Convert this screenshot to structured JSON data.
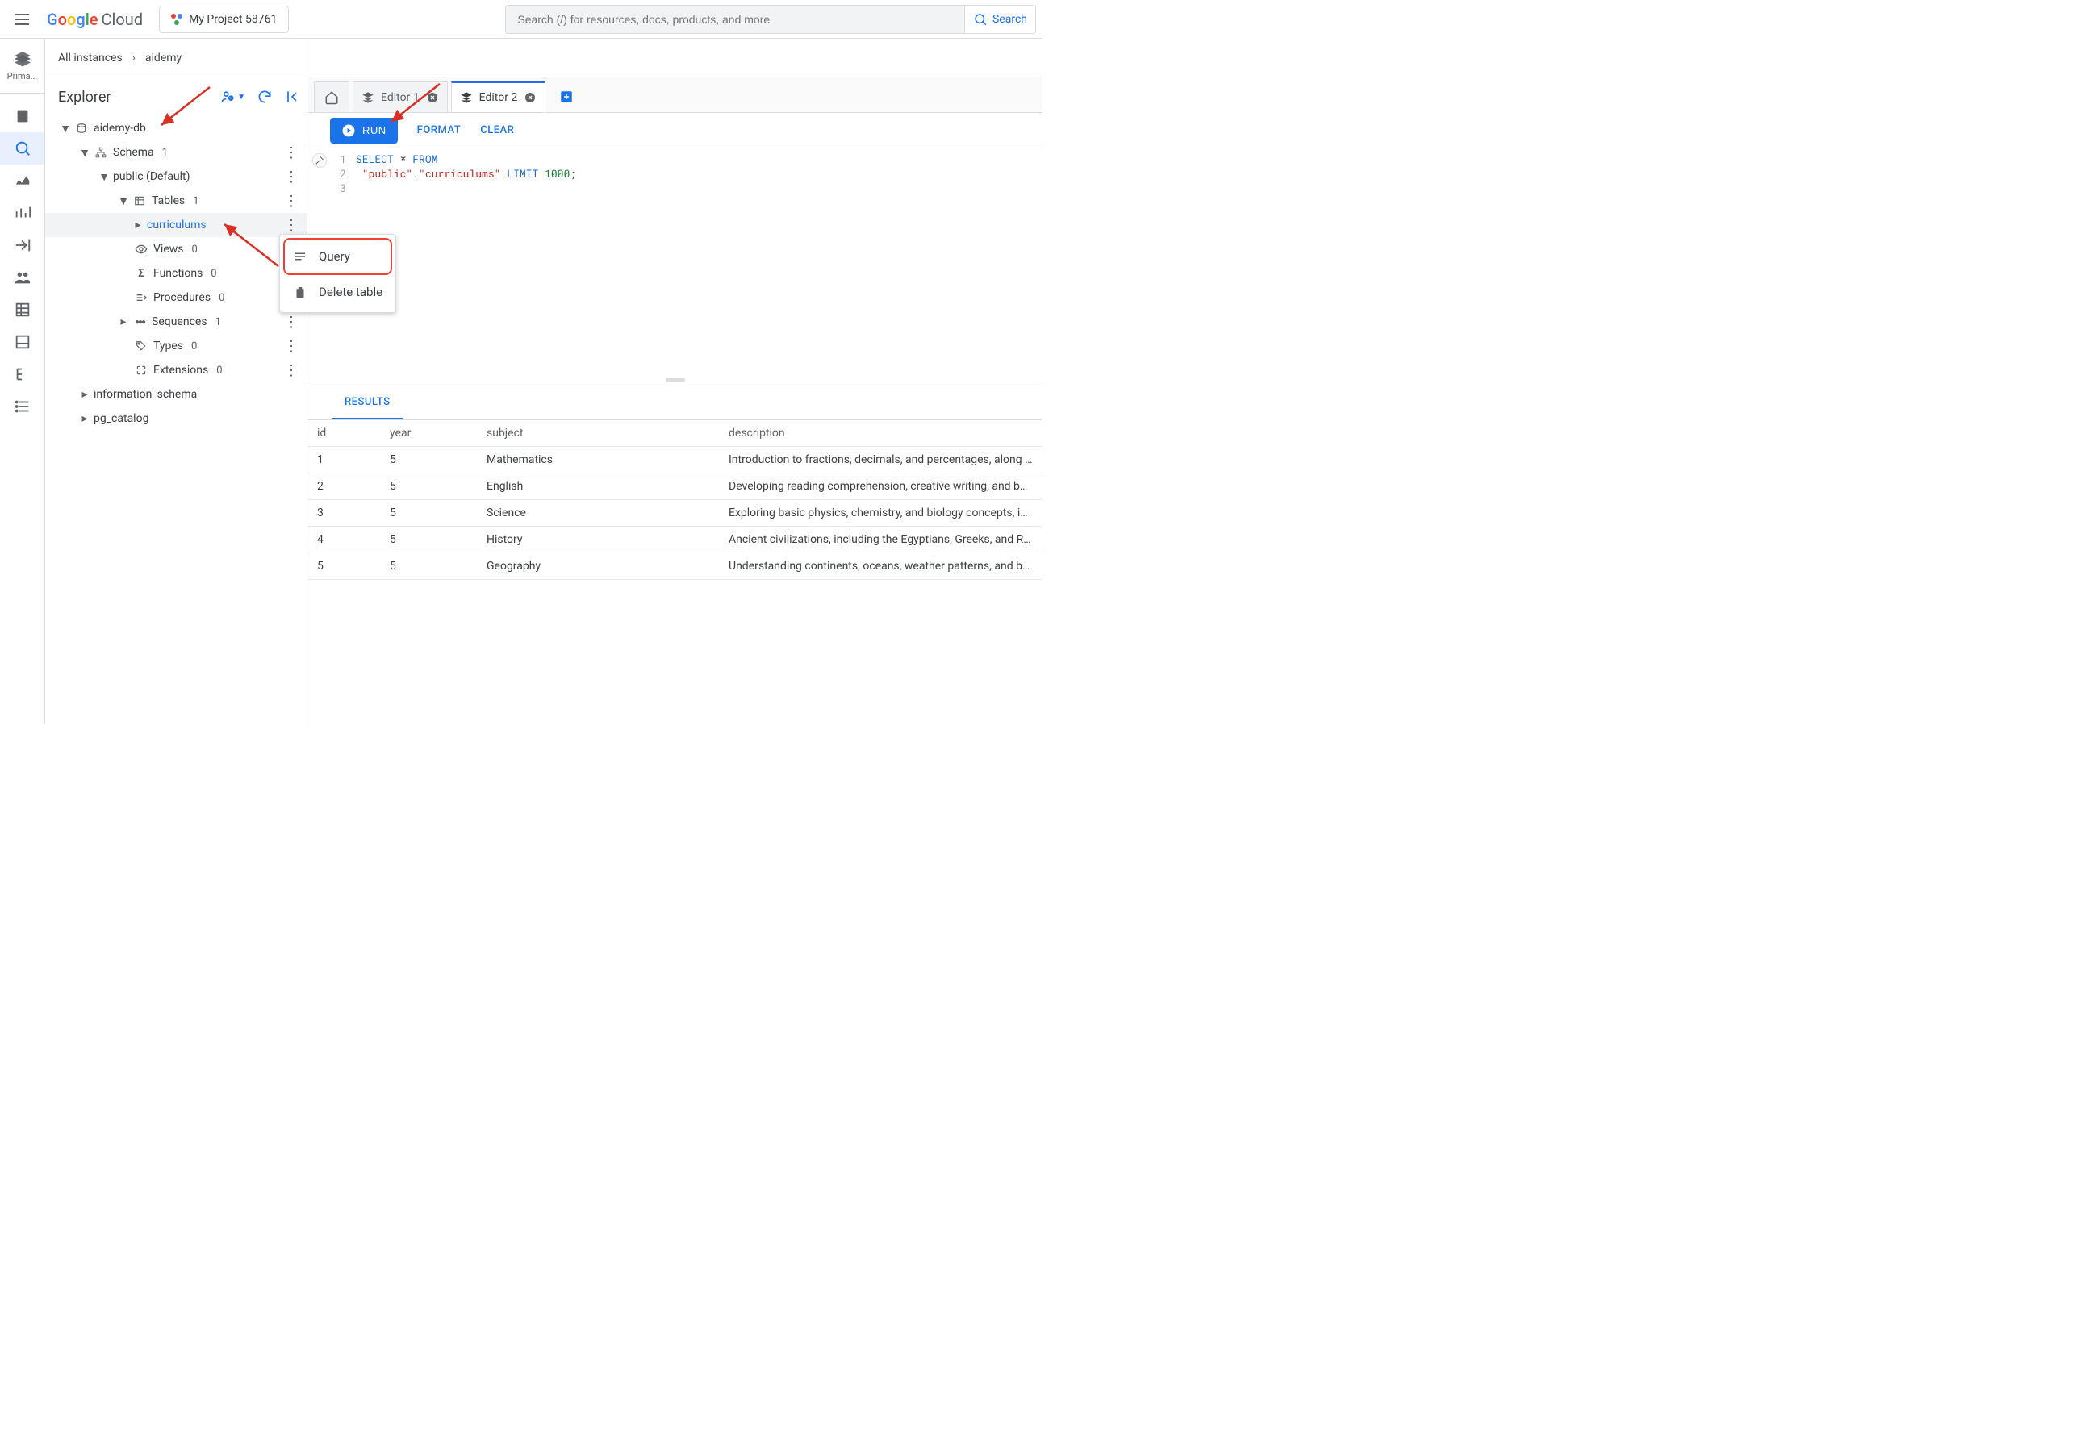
{
  "header": {
    "logo_text": "Cloud",
    "project_name": "My Project 58761",
    "search_placeholder": "Search (/) for resources, docs, products, and more",
    "search_button_label": "Search"
  },
  "rail": {
    "product_label": "Prima..."
  },
  "breadcrumbs": {
    "root": "All instances",
    "current": "aidemy"
  },
  "explorer": {
    "title": "Explorer",
    "db_name": "aidemy-db",
    "schema_label": "Schema",
    "schema_count": "1",
    "public_label": "public (Default)",
    "tables_label": "Tables",
    "tables_count": "1",
    "curriculums_label": "curriculums",
    "views_label": "Views",
    "views_count": "0",
    "functions_label": "Functions",
    "functions_count": "0",
    "procedures_label": "Procedures",
    "procedures_count": "0",
    "sequences_label": "Sequences",
    "sequences_count": "1",
    "types_label": "Types",
    "types_count": "0",
    "extensions_label": "Extensions",
    "extensions_count": "0",
    "info_schema_label": "information_schema",
    "pg_catalog_label": "pg_catalog"
  },
  "context_menu": {
    "query_label": "Query",
    "delete_label": "Delete table"
  },
  "tabs": {
    "editor1": "Editor 1",
    "editor2": "Editor 2"
  },
  "toolbar": {
    "run_label": "RUN",
    "format_label": "FORMAT",
    "clear_label": "CLEAR"
  },
  "sql": {
    "line1_kw": "SELECT",
    "line1_rest": " * ",
    "line1_from": "FROM",
    "line2_q1": "\"public\"",
    "line2_dot": ".",
    "line2_q2": "\"curriculums\"",
    "line2_limit": " LIMIT ",
    "line2_num": "1000",
    "line2_semi": ";"
  },
  "results": {
    "tab_label": "RESULTS",
    "columns": {
      "c1": "id",
      "c2": "year",
      "c3": "subject",
      "c4": "description"
    },
    "rows": [
      {
        "id": "1",
        "year": "5",
        "subject": "Mathematics",
        "description": "Introduction to fractions, decimals, and percentages, along with foun"
      },
      {
        "id": "2",
        "year": "5",
        "subject": "English",
        "description": "Developing reading comprehension, creative writing, and basic gramm"
      },
      {
        "id": "3",
        "year": "5",
        "subject": "Science",
        "description": "Exploring basic physics, chemistry, and biology concepts, including f"
      },
      {
        "id": "4",
        "year": "5",
        "subject": "History",
        "description": "Ancient civilizations, including the Egyptians, Greeks, and Romans, w"
      },
      {
        "id": "5",
        "year": "5",
        "subject": "Geography",
        "description": "Understanding continents, oceans, weather patterns, and basic map-"
      }
    ]
  }
}
